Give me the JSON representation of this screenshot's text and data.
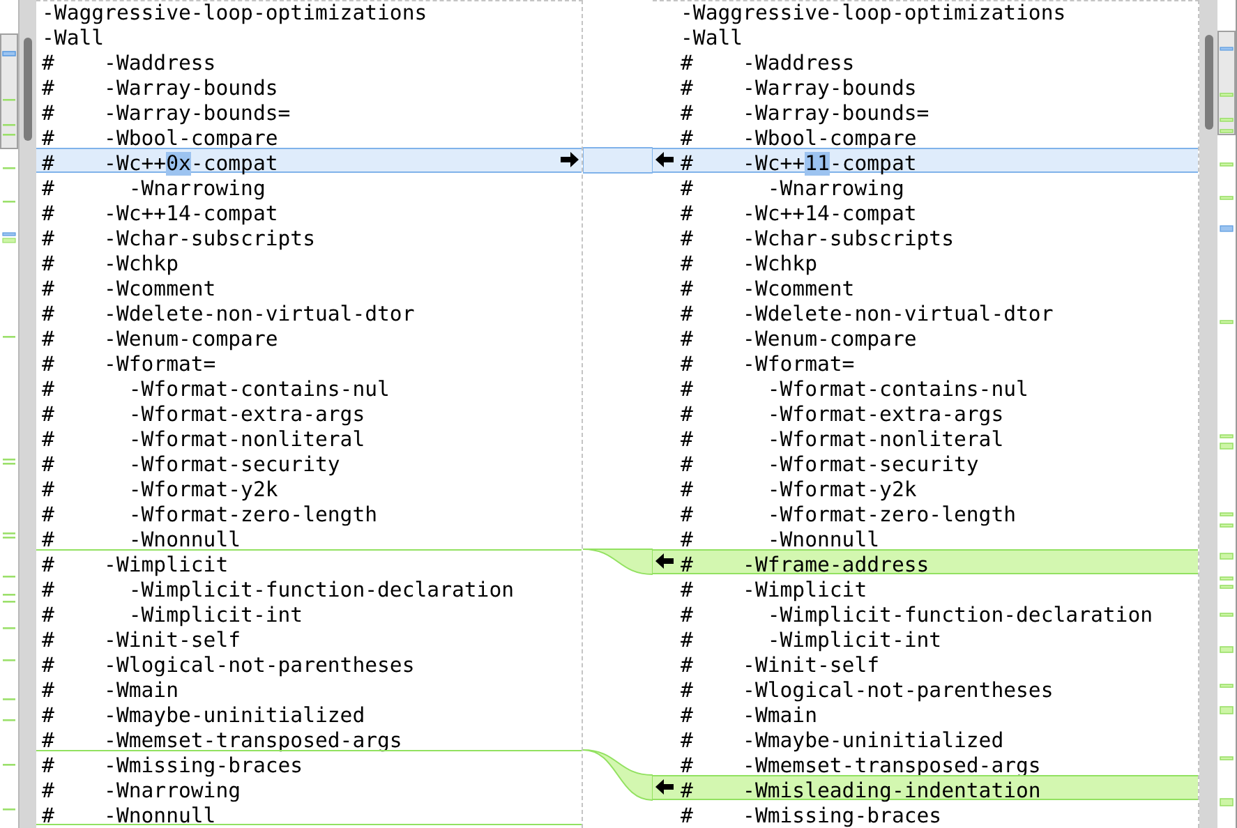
{
  "left_pane": {
    "lines": [
      {
        "kind": "equal",
        "text": "-Waggressive-loop-optimizations"
      },
      {
        "kind": "equal",
        "text": "-Wall"
      },
      {
        "kind": "equal",
        "text": "#    -Waddress"
      },
      {
        "kind": "equal",
        "text": "#    -Warray-bounds"
      },
      {
        "kind": "equal",
        "text": "#    -Warray-bounds="
      },
      {
        "kind": "equal",
        "text": "#    -Wbool-compare"
      },
      {
        "kind": "changed",
        "segments": [
          {
            "text": "#    -Wc++",
            "highlight": false
          },
          {
            "text": "0x",
            "highlight": true
          },
          {
            "text": "-compat",
            "highlight": false
          }
        ]
      },
      {
        "kind": "equal",
        "text": "#      -Wnarrowing"
      },
      {
        "kind": "equal",
        "text": "#    -Wc++14-compat"
      },
      {
        "kind": "equal",
        "text": "#    -Wchar-subscripts"
      },
      {
        "kind": "equal",
        "text": "#    -Wchkp"
      },
      {
        "kind": "equal",
        "text": "#    -Wcomment"
      },
      {
        "kind": "equal",
        "text": "#    -Wdelete-non-virtual-dtor"
      },
      {
        "kind": "equal",
        "text": "#    -Wenum-compare"
      },
      {
        "kind": "equal",
        "text": "#    -Wformat="
      },
      {
        "kind": "equal",
        "text": "#      -Wformat-contains-nul"
      },
      {
        "kind": "equal",
        "text": "#      -Wformat-extra-args"
      },
      {
        "kind": "equal",
        "text": "#      -Wformat-nonliteral"
      },
      {
        "kind": "equal",
        "text": "#      -Wformat-security"
      },
      {
        "kind": "equal",
        "text": "#      -Wformat-y2k"
      },
      {
        "kind": "equal",
        "text": "#      -Wformat-zero-length"
      },
      {
        "kind": "equal",
        "text": "#      -Wnonnull"
      },
      {
        "kind": "equal",
        "text": "#    -Wimplicit",
        "gap_before": true
      },
      {
        "kind": "equal",
        "text": "#      -Wimplicit-function-declaration"
      },
      {
        "kind": "equal",
        "text": "#      -Wimplicit-int"
      },
      {
        "kind": "equal",
        "text": "#    -Winit-self"
      },
      {
        "kind": "equal",
        "text": "#    -Wlogical-not-parentheses"
      },
      {
        "kind": "equal",
        "text": "#    -Wmain"
      },
      {
        "kind": "equal",
        "text": "#    -Wmaybe-uninitialized"
      },
      {
        "kind": "equal",
        "text": "#    -Wmemset-transposed-args"
      },
      {
        "kind": "equal",
        "text": "#    -Wmissing-braces",
        "gap_before": true
      },
      {
        "kind": "equal",
        "text": "#    -Wnarrowing"
      },
      {
        "kind": "equal",
        "text": "#    -Wnonnull",
        "gap_after": true
      }
    ]
  },
  "right_pane": {
    "lines": [
      {
        "kind": "equal",
        "text": "-Waggressive-loop-optimizations"
      },
      {
        "kind": "equal",
        "text": "-Wall"
      },
      {
        "kind": "equal",
        "text": "#    -Waddress"
      },
      {
        "kind": "equal",
        "text": "#    -Warray-bounds"
      },
      {
        "kind": "equal",
        "text": "#    -Warray-bounds="
      },
      {
        "kind": "equal",
        "text": "#    -Wbool-compare"
      },
      {
        "kind": "changed",
        "segments": [
          {
            "text": "#    -Wc++",
            "highlight": false
          },
          {
            "text": "11",
            "highlight": true
          },
          {
            "text": "-compat",
            "highlight": false
          }
        ]
      },
      {
        "kind": "equal",
        "text": "#      -Wnarrowing"
      },
      {
        "kind": "equal",
        "text": "#    -Wc++14-compat"
      },
      {
        "kind": "equal",
        "text": "#    -Wchar-subscripts"
      },
      {
        "kind": "equal",
        "text": "#    -Wchkp"
      },
      {
        "kind": "equal",
        "text": "#    -Wcomment"
      },
      {
        "kind": "equal",
        "text": "#    -Wdelete-non-virtual-dtor"
      },
      {
        "kind": "equal",
        "text": "#    -Wenum-compare"
      },
      {
        "kind": "equal",
        "text": "#    -Wformat="
      },
      {
        "kind": "equal",
        "text": "#      -Wformat-contains-nul"
      },
      {
        "kind": "equal",
        "text": "#      -Wformat-extra-args"
      },
      {
        "kind": "equal",
        "text": "#      -Wformat-nonliteral"
      },
      {
        "kind": "equal",
        "text": "#      -Wformat-security"
      },
      {
        "kind": "equal",
        "text": "#      -Wformat-y2k"
      },
      {
        "kind": "equal",
        "text": "#      -Wformat-zero-length"
      },
      {
        "kind": "equal",
        "text": "#      -Wnonnull"
      },
      {
        "kind": "inserted",
        "text": "#    -Wframe-address"
      },
      {
        "kind": "equal",
        "text": "#    -Wimplicit"
      },
      {
        "kind": "equal",
        "text": "#      -Wimplicit-function-declaration"
      },
      {
        "kind": "equal",
        "text": "#      -Wimplicit-int"
      },
      {
        "kind": "equal",
        "text": "#    -Winit-self"
      },
      {
        "kind": "equal",
        "text": "#    -Wlogical-not-parentheses"
      },
      {
        "kind": "equal",
        "text": "#    -Wmain"
      },
      {
        "kind": "equal",
        "text": "#    -Wmaybe-uninitialized"
      },
      {
        "kind": "equal",
        "text": "#    -Wmemset-transposed-args"
      },
      {
        "kind": "inserted",
        "text": "#    -Wmisleading-indentation"
      },
      {
        "kind": "equal",
        "text": "#    -Wmissing-braces"
      }
    ]
  }
}
